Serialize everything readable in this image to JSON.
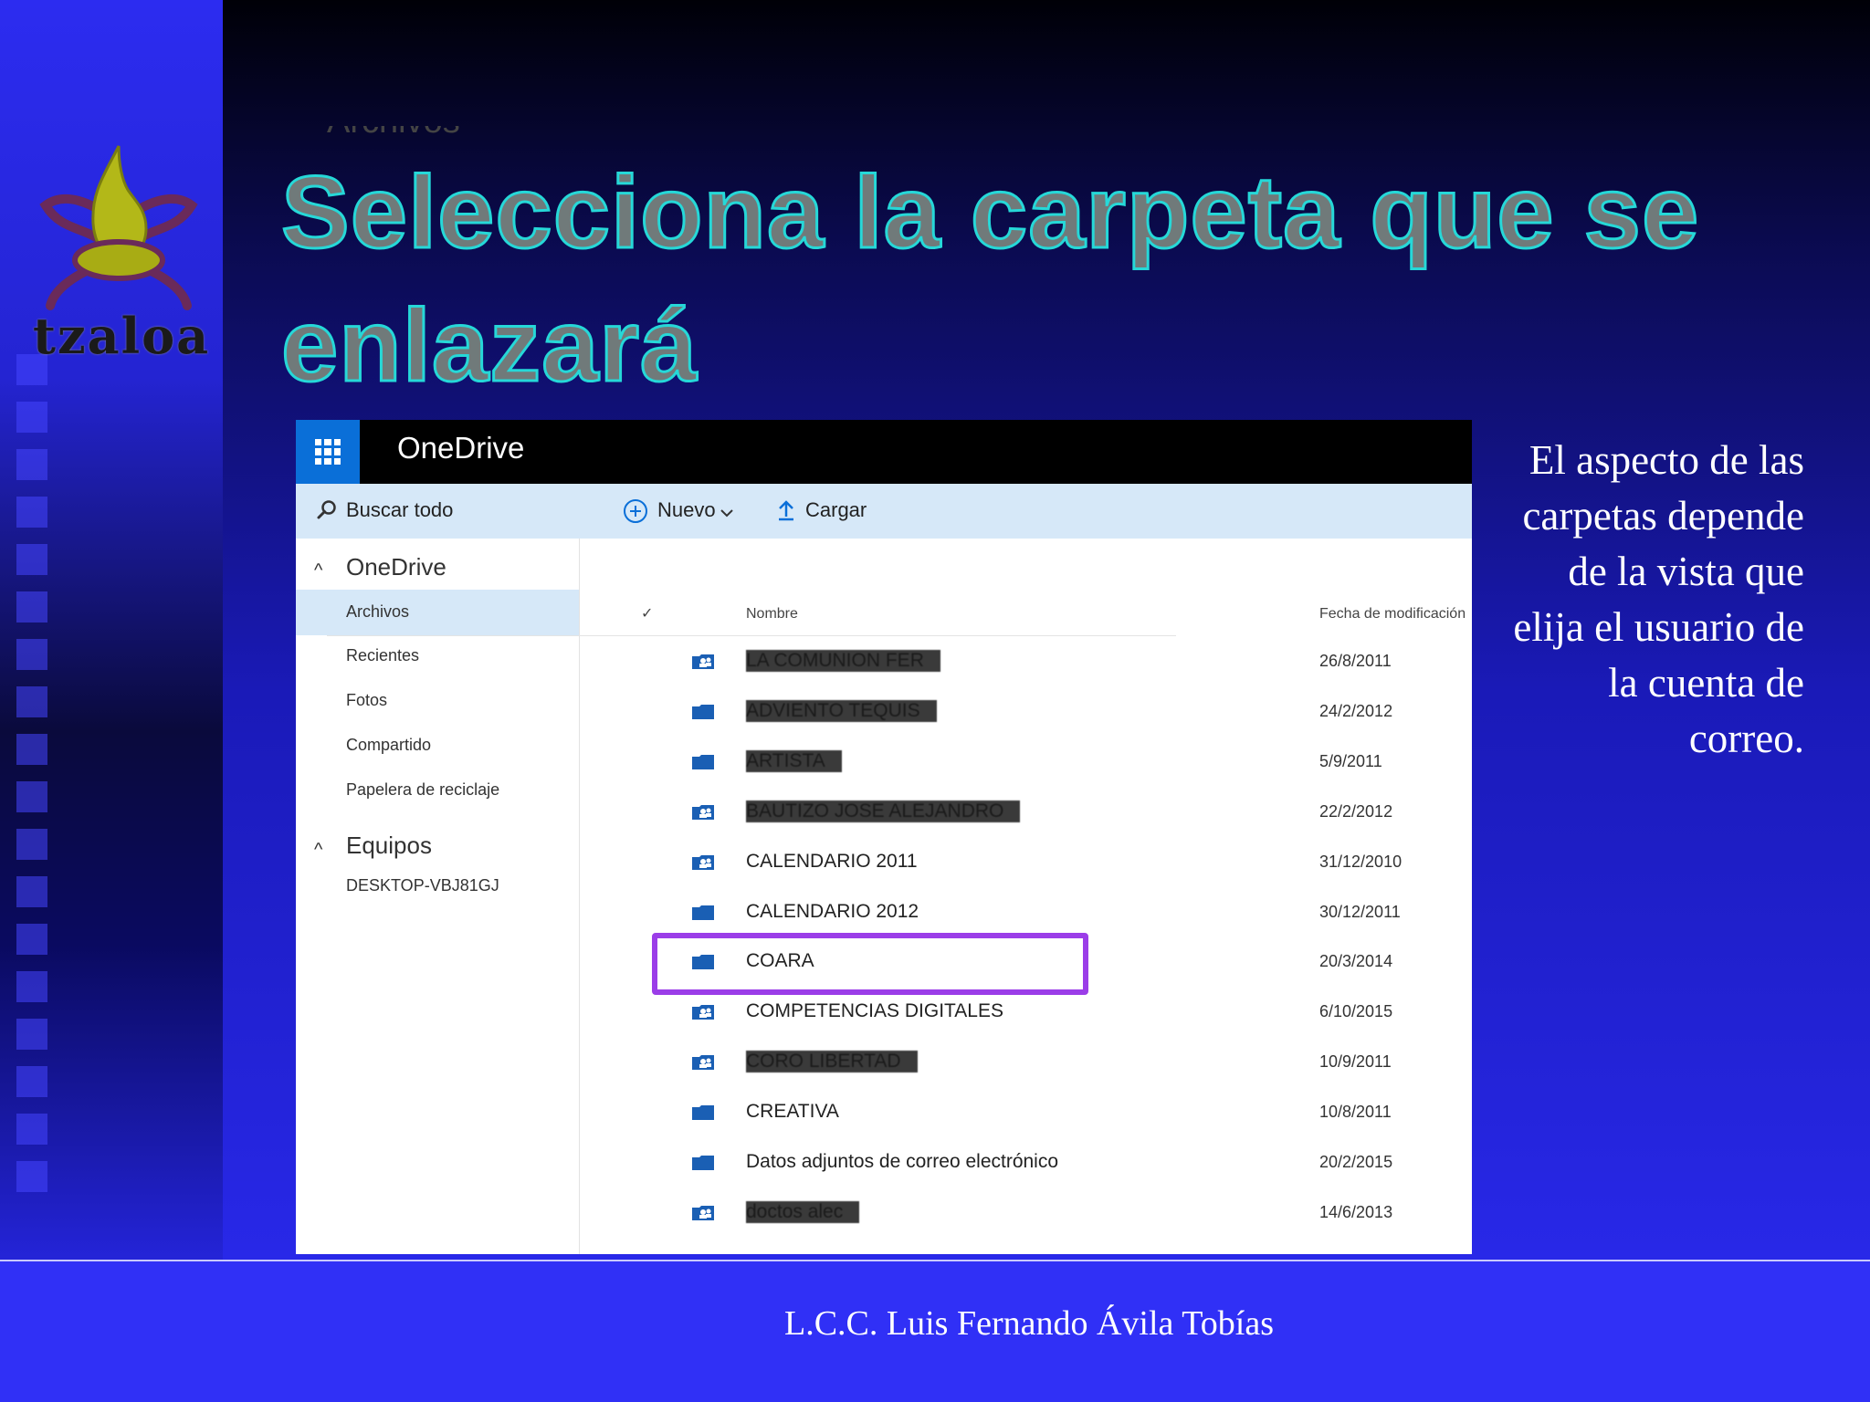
{
  "slide": {
    "title": "Selecciona la carpeta que se enlazará",
    "logo_text": "tzaloa",
    "side_note": "El aspecto de las carpetas depende de la vista que elija el usuario de la cuenta de correo.",
    "author": "L.C.C. Luis Fernando Ávila Tobías",
    "colors": {
      "title_fill": "#707a7a",
      "title_outline": "#26d8d8",
      "highlight": "#9b3de8",
      "onedrive_blue": "#0a6fd8"
    }
  },
  "onedrive": {
    "brand": "OneDrive",
    "search_label": "Buscar todo",
    "toolbar": {
      "new_label": "Nuevo",
      "upload_label": "Cargar"
    },
    "page_heading": "Archivos",
    "nav": {
      "onedrive_section": "OneDrive",
      "items": [
        "Archivos",
        "Recientes",
        "Fotos",
        "Compartido",
        "Papelera de reciclaje"
      ],
      "selected": "Archivos",
      "devices_section": "Equipos",
      "devices": [
        "DESKTOP-VBJ81GJ"
      ]
    },
    "columns": {
      "check": "✓",
      "name": "Nombre",
      "modified": "Fecha de modificación"
    },
    "files": [
      {
        "name": "LA COMUNION FER",
        "date": "26/8/2011",
        "icon": "shared-folder-icon",
        "redacted": true
      },
      {
        "name": "ADVIENTO TEQUIS",
        "date": "24/2/2012",
        "icon": "folder-icon",
        "redacted": true
      },
      {
        "name": "ARTISTA",
        "date": "5/9/2011",
        "icon": "folder-icon",
        "redacted": true
      },
      {
        "name": "BAUTIZO JOSE ALEJANDRO",
        "date": "22/2/2012",
        "icon": "shared-folder-icon",
        "redacted": true
      },
      {
        "name": "CALENDARIO 2011",
        "date": "31/12/2010",
        "icon": "shared-folder-icon",
        "redacted": false
      },
      {
        "name": "CALENDARIO 2012",
        "date": "30/12/2011",
        "icon": "folder-icon",
        "redacted": false
      },
      {
        "name": "COARA",
        "date": "20/3/2014",
        "icon": "folder-icon",
        "redacted": false
      },
      {
        "name": "COMPETENCIAS DIGITALES",
        "date": "6/10/2015",
        "icon": "shared-folder-icon",
        "redacted": false
      },
      {
        "name": "CORO LIBERTAD",
        "date": "10/9/2011",
        "icon": "shared-folder-icon",
        "redacted": true
      },
      {
        "name": "CREATIVA",
        "date": "10/8/2011",
        "icon": "folder-icon",
        "redacted": false
      },
      {
        "name": "Datos adjuntos de correo electrónico",
        "date": "20/2/2015",
        "icon": "folder-icon",
        "redacted": false
      },
      {
        "name": "doctos alec",
        "date": "14/6/2013",
        "icon": "shared-folder-icon",
        "redacted": true
      }
    ],
    "highlighted_file": "COARA"
  }
}
